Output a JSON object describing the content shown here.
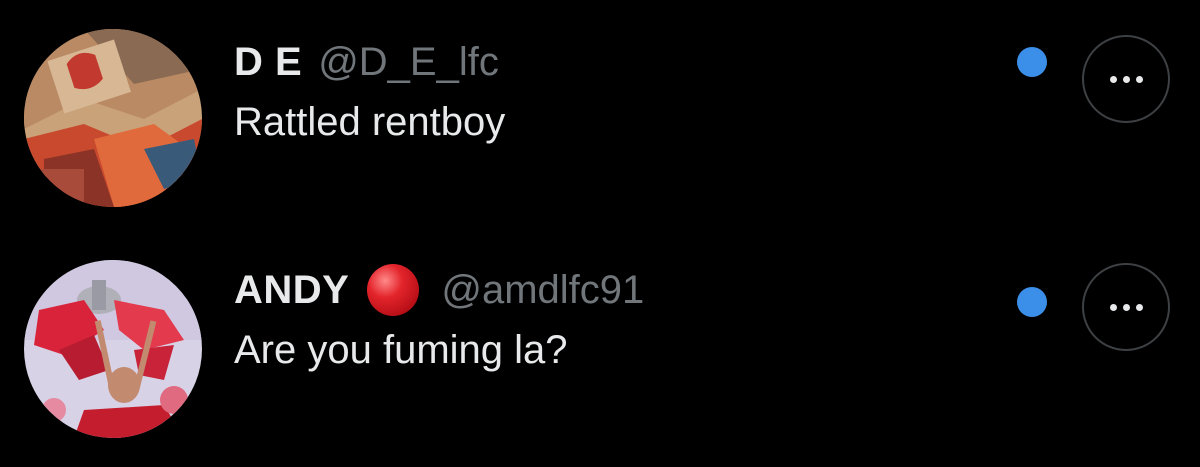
{
  "replies": [
    {
      "display_name": "D E",
      "handle": "@D_E_lfc",
      "text": "Rattled rentboy",
      "has_status_emoji": false,
      "unread": true,
      "avatar_icon": "liverpool-stand-photo"
    },
    {
      "display_name": "ANDY",
      "handle": "@amdlfc91",
      "text": "Are you fuming la?",
      "has_status_emoji": true,
      "status_emoji": "red-circle-icon",
      "unread": true,
      "avatar_icon": "trophy-celebration-photo"
    }
  ],
  "colors": {
    "background": "#000000",
    "primary_text": "#e7e9ea",
    "secondary_text": "#71767b",
    "unread_dot": "#3b8fe8",
    "status_red": "#e3242b",
    "button_border": "#3e4144"
  }
}
